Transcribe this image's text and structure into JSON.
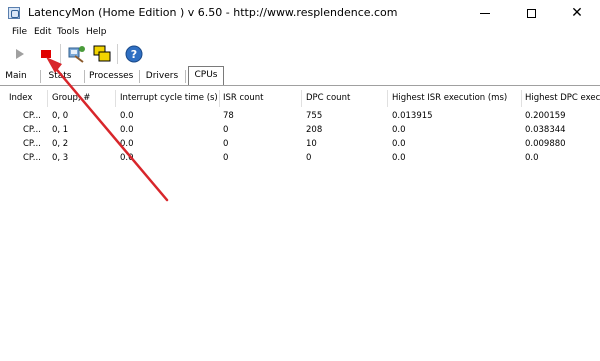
{
  "window": {
    "title": "LatencyMon  (Home Edition )  v 6.50 - http://www.resplendence.com",
    "min_glyph": "—",
    "max_glyph": "☐",
    "close_glyph": "✕"
  },
  "menu": [
    "File",
    "Edit",
    "Tools",
    "Help"
  ],
  "toolbar": {
    "play_icon": "play-icon",
    "stop_icon": "stop-icon",
    "stop_color": "#e00000",
    "tools_icon": "tools-icon",
    "windows_icon": "windows-icon",
    "help_icon": "help-icon"
  },
  "tabs": [
    "Main",
    "Stats",
    "Processes",
    "Drivers",
    "CPUs"
  ],
  "active_tab": "CPUs",
  "table": {
    "headers": [
      "Index",
      "Group, #",
      "Interrupt cycle time (s)",
      "ISR count",
      "DPC count",
      "Highest ISR execution (ms)",
      "Highest DPC exec"
    ],
    "rows": [
      [
        "CP...",
        "0, 0",
        "0.0",
        "78",
        "755",
        "0.013915",
        "0.200159"
      ],
      [
        "CP...",
        "0, 1",
        "0.0",
        "0",
        "208",
        "0.0",
        "0.038344"
      ],
      [
        "CP...",
        "0, 2",
        "0.0",
        "0",
        "10",
        "0.0",
        "0.009880"
      ],
      [
        "CP...",
        "0, 3",
        "0.0",
        "0",
        "0",
        "0.0",
        "0.0"
      ]
    ]
  },
  "annotation_arrow_color": "#d8262b"
}
